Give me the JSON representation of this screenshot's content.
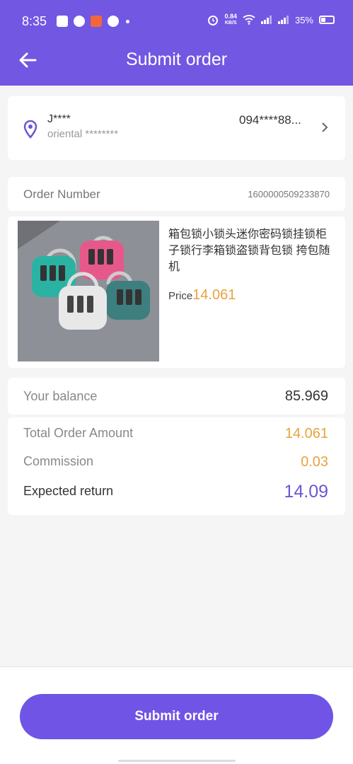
{
  "status_bar": {
    "time": "8:35",
    "net_speed": "0.84",
    "net_unit": "KB/S",
    "battery": "35%"
  },
  "header": {
    "title": "Submit order"
  },
  "address": {
    "name": "J****",
    "street": "oriental ********",
    "phone": "094****88..."
  },
  "order": {
    "number_label": "Order Number",
    "number": "1600000509233870"
  },
  "product": {
    "name": "箱包锁小锁头迷你密码锁挂锁柜子锁行李箱锁盗锁背包锁 挎包随机",
    "price_label": "Price",
    "price": "14.061"
  },
  "balance": {
    "label": "Your balance",
    "value": "85.969"
  },
  "totals": {
    "order_amount_label": "Total Order Amount",
    "order_amount": "14.061",
    "commission_label": "Commission",
    "commission": "0.03",
    "return_label": "Expected return",
    "return": "14.09"
  },
  "footer": {
    "submit_label": "Submit order"
  },
  "colors": {
    "primary": "#7257e3",
    "accent": "#e7a33e",
    "return": "#6e54d9"
  }
}
